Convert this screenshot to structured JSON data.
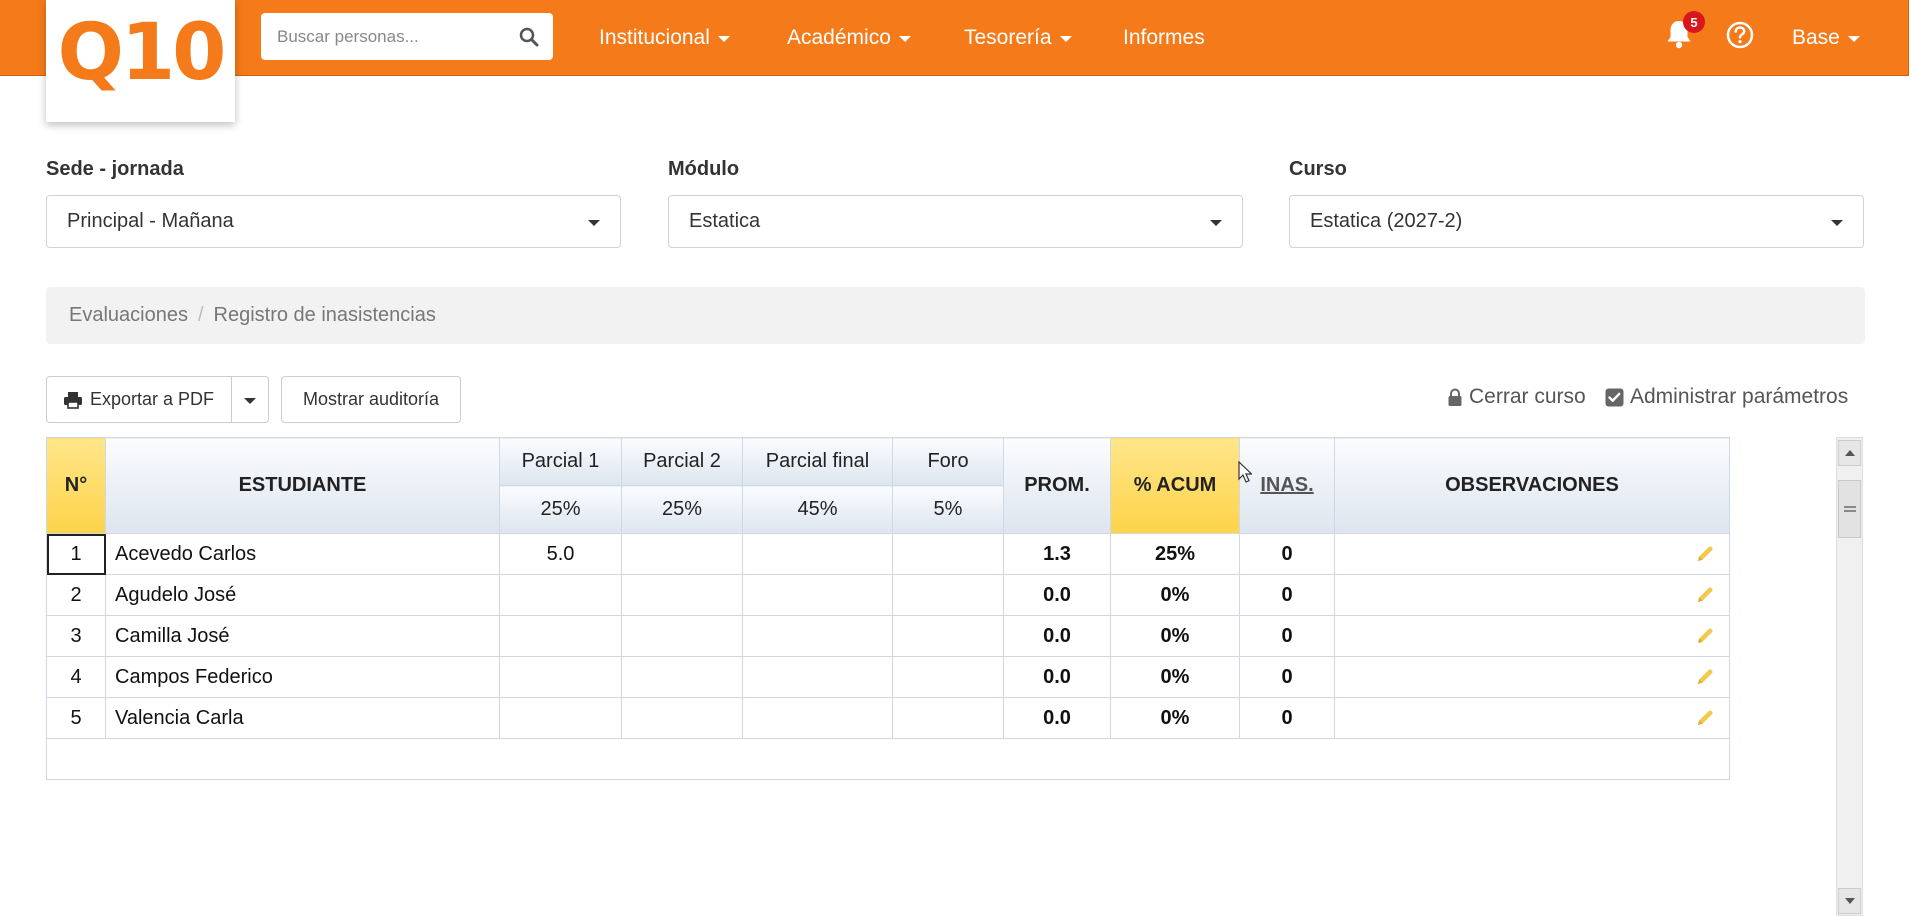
{
  "header": {
    "logo_text": "Q10",
    "search": {
      "placeholder": "Buscar personas..."
    },
    "nav": [
      {
        "label": "Institucional",
        "dropdown": true
      },
      {
        "label": "Académico",
        "dropdown": true
      },
      {
        "label": "Tesorería",
        "dropdown": true
      },
      {
        "label": "Informes",
        "dropdown": false
      }
    ],
    "notifications_count": "5",
    "user_menu": "Base",
    "accent_color": "#f47a1a"
  },
  "filters": {
    "sede": {
      "label": "Sede - jornada",
      "value": "Principal - Mañana"
    },
    "modulo": {
      "label": "Módulo",
      "value": "Estatica"
    },
    "curso": {
      "label": "Curso",
      "value": "Estatica (2027-2)"
    }
  },
  "breadcrumb": {
    "items": [
      "Evaluaciones",
      "Registro de inasistencias"
    ],
    "separator": "/"
  },
  "toolbar": {
    "export_label": "Exportar a PDF",
    "audit_label": "Mostrar auditoría",
    "close_course": "Cerrar curso",
    "admin_params": "Administrar parámetros"
  },
  "grades": {
    "columns": {
      "num": "N°",
      "student": "ESTUDIANTE",
      "parcial1": "Parcial 1",
      "parcial1_pct": "25%",
      "parcial2": "Parcial 2",
      "parcial2_pct": "25%",
      "final": "Parcial final",
      "final_pct": "45%",
      "foro": "Foro",
      "foro_pct": "5%",
      "prom": "PROM.",
      "acum": "% ACUM",
      "inas": "INAS.",
      "obs": "OBSERVACIONES"
    },
    "rows": [
      {
        "n": "1",
        "name": "Acevedo Carlos",
        "p1": "5.0",
        "p2": "",
        "pf": "",
        "foro": "",
        "prom": "1.3",
        "acum": "25%",
        "inas": "0"
      },
      {
        "n": "2",
        "name": "Agudelo José",
        "p1": "",
        "p2": "",
        "pf": "",
        "foro": "",
        "prom": "0.0",
        "acum": "0%",
        "inas": "0"
      },
      {
        "n": "3",
        "name": "Camilla José",
        "p1": "",
        "p2": "",
        "pf": "",
        "foro": "",
        "prom": "0.0",
        "acum": "0%",
        "inas": "0"
      },
      {
        "n": "4",
        "name": "Campos Federico",
        "p1": "",
        "p2": "",
        "pf": "",
        "foro": "",
        "prom": "0.0",
        "acum": "0%",
        "inas": "0"
      },
      {
        "n": "5",
        "name": "Valencia Carla",
        "p1": "",
        "p2": "",
        "pf": "",
        "foro": "",
        "prom": "0.0",
        "acum": "0%",
        "inas": "0"
      }
    ]
  }
}
